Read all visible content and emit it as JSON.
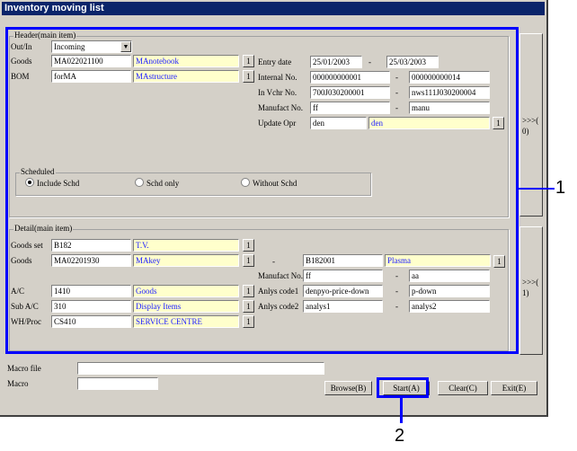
{
  "window": {
    "title": "Inventory moving list"
  },
  "header": {
    "group_label": "Header(main item)",
    "out_in": {
      "label": "Out/In",
      "value": "Incoming"
    },
    "goods": {
      "label": "Goods",
      "code": "MA022021100",
      "name": "MAnotebook"
    },
    "bom": {
      "label": "BOM",
      "code": "forMA",
      "name": "MAstructure"
    },
    "entry_date": {
      "label": "Entry date",
      "from": "25/01/2003",
      "to": "25/03/2003"
    },
    "internal_no": {
      "label": "Internal No.",
      "from": "000000000001",
      "to": "000000000014"
    },
    "in_vchr_no": {
      "label": "In Vchr No.",
      "from": "700J030200001",
      "to": "nws111J030200004"
    },
    "manufact_no": {
      "label": "Manufact No.",
      "from": "ff",
      "to": "manu"
    },
    "update_opr": {
      "label": "Update Opr",
      "code": "den",
      "name": "den"
    },
    "scheduled": {
      "label": "Scheduled",
      "options": [
        "Include Schd",
        "Schd only",
        "Without Schd"
      ],
      "selected": "Include Schd"
    },
    "side_label": ">>>(\n0)"
  },
  "detail": {
    "group_label": "Detail(main item)",
    "goods_set": {
      "label": "Goods set",
      "code": "B182",
      "name": "T.V."
    },
    "goods": {
      "label": "Goods",
      "code": "MA02201930",
      "name": "MAkey",
      "to_code": "B182001",
      "to_name": "Plasma"
    },
    "manufact_no": {
      "label": "Manufact No.",
      "from": "ff",
      "to": "aa"
    },
    "ac": {
      "label": "A/C",
      "code": "1410",
      "name": "Goods"
    },
    "sub_ac": {
      "label": "Sub A/C",
      "code": "310",
      "name": "Display Items"
    },
    "wh_proc": {
      "label": "WH/Proc",
      "code": "CS410",
      "name": "SERVICE CENTRE"
    },
    "anlys_code1": {
      "label": "Anlys code1",
      "from": "denpyo-price-down",
      "to": "p-down"
    },
    "anlys_code2": {
      "label": "Anlys code2",
      "from": "analys1",
      "to": "analys2"
    },
    "side_label": ">>>(\n1)"
  },
  "macro": {
    "file_label": "Macro file",
    "file_value": "",
    "label": "Macro",
    "value": ""
  },
  "buttons": {
    "browse": "Browse(B)",
    "start": "Start(A)",
    "clear": "Clear(C)",
    "exit": "Exit(E)",
    "lookup": "1",
    "dash": "-"
  },
  "callouts": {
    "one": "1",
    "two": "2"
  },
  "colors": {
    "highlight": "#0000ff",
    "title_bar": "#0a246a",
    "name_field_bg": "#ffffcc",
    "name_field_text": "#2020ff"
  }
}
